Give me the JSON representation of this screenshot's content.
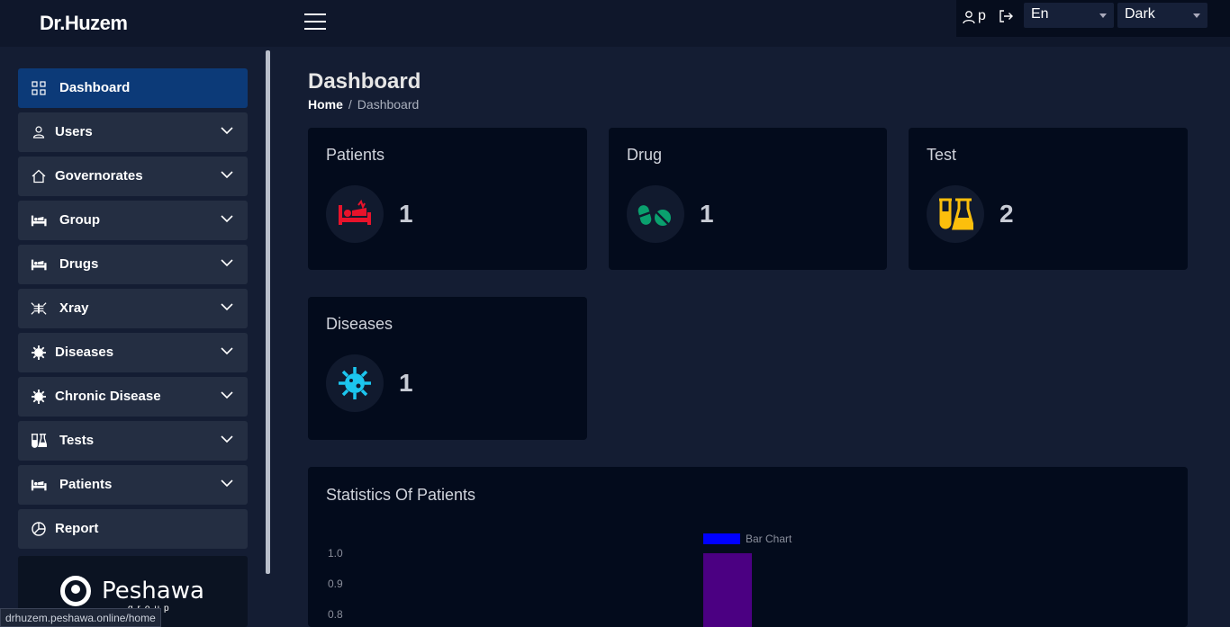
{
  "app": {
    "brand": "Dr.Huzem"
  },
  "topbar": {
    "user_name": "p",
    "language": "En",
    "theme": "Dark"
  },
  "sidebar": {
    "items": [
      {
        "label": "Dashboard",
        "icon": "grid-icon",
        "active": true,
        "expandable": false
      },
      {
        "label": "Users",
        "icon": "user-icon",
        "expandable": true
      },
      {
        "label": "Governorates",
        "icon": "home-icon",
        "expandable": true
      },
      {
        "label": "Group",
        "icon": "bed-icon",
        "expandable": true
      },
      {
        "label": "Drugs",
        "icon": "bed-icon",
        "expandable": true
      },
      {
        "label": "Xray",
        "icon": "xray-icon",
        "expandable": true
      },
      {
        "label": "Diseases",
        "icon": "virus-icon",
        "expandable": true
      },
      {
        "label": "Chronic Disease",
        "icon": "virus-icon",
        "expandable": true
      },
      {
        "label": "Tests",
        "icon": "flask-icon",
        "expandable": true
      },
      {
        "label": "Patients",
        "icon": "bed-icon",
        "expandable": true
      },
      {
        "label": "Report",
        "icon": "pie-icon",
        "expandable": false
      }
    ],
    "logo": {
      "text": "Peshawa",
      "sub": "group"
    }
  },
  "status_url": "drhuzem.peshawa.online/home",
  "page": {
    "title": "Dashboard",
    "breadcrumb": {
      "home": "Home",
      "separator": "/",
      "current": "Dashboard"
    }
  },
  "cards": [
    {
      "title": "Patients",
      "value": "1",
      "icon": "bed-icon",
      "color": "#e8132b"
    },
    {
      "title": "Drug",
      "value": "1",
      "icon": "pills-icon",
      "color": "#0aa06e"
    },
    {
      "title": "Test",
      "value": "2",
      "icon": "flask-icon",
      "color": "#fcbf0c"
    },
    {
      "title": "Diseases",
      "value": "1",
      "icon": "virus-icon",
      "color": "#1cc6ef"
    }
  ],
  "stats": {
    "title": "Statistics Of Patients"
  },
  "chart_data": {
    "type": "bar",
    "legend": [
      "Bar Chart"
    ],
    "series": [
      {
        "name": "Bar Chart",
        "values": [
          1
        ]
      }
    ],
    "y_ticks": [
      "1.0",
      "0.9",
      "0.8"
    ],
    "ylim": [
      0.8,
      1.0
    ],
    "colors": {
      "legend_box": "#0000ff",
      "bar": "#4b0082"
    },
    "legend_placement": "top"
  }
}
